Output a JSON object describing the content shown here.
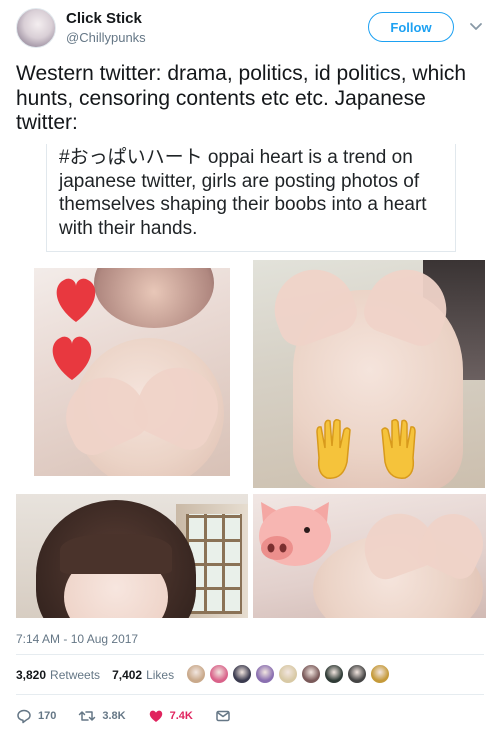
{
  "author": {
    "display_name": "Click Stick",
    "handle": "@Chillypunks",
    "follow_label": "Follow"
  },
  "tweet": {
    "text": "Western twitter: drama, politics, id politics, which hunts, censoring contents etc etc. Japanese twitter:"
  },
  "quoted": {
    "text": "#おっぱいハート oppai heart is a trend on japanese twitter, girls are posting photos of themselves shaping their boobs into a heart with their hands."
  },
  "meta": {
    "timestamp": "7:14 AM - 10 Aug 2017"
  },
  "stats": {
    "retweets_count": "3,820",
    "retweets_label": "Retweets",
    "likes_count": "7,402",
    "likes_label": "Likes",
    "liker_colors": [
      "#c9a98b",
      "#d9638a",
      "#3b3b4f",
      "#8a6fb0",
      "#d8c9a5",
      "#7a5a5a",
      "#2f3b36",
      "#444444",
      "#c59a3a"
    ]
  },
  "actions": {
    "replies": "170",
    "retweets": "3.8K",
    "likes": "7.4K"
  },
  "colors": {
    "accent": "#1da1f2",
    "like": "#e0245e",
    "muted": "#657786"
  }
}
